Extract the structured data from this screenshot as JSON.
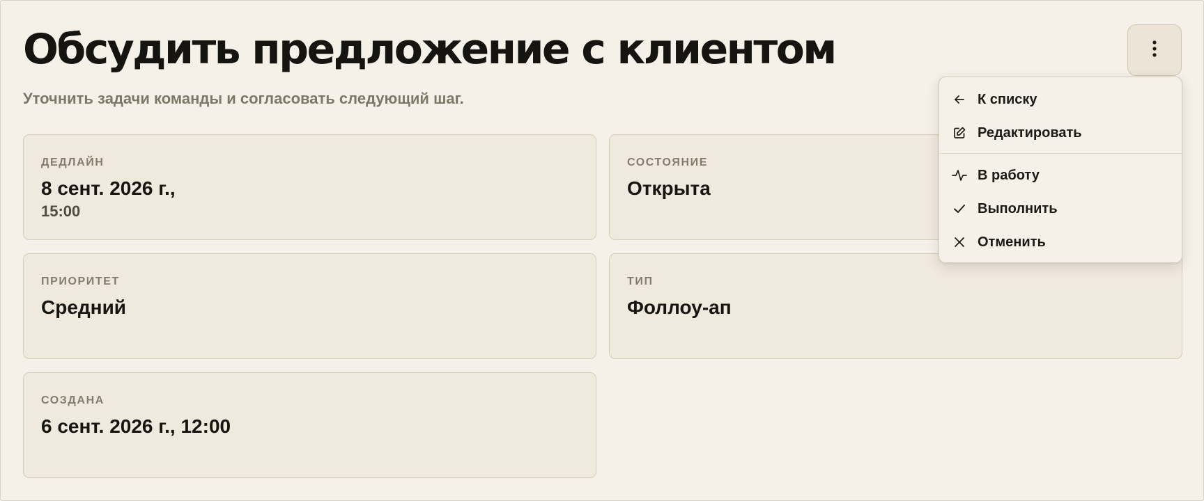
{
  "task": {
    "title": "Обсудить предложение с клиентом",
    "subtitle": "Уточнить задачи команды и согласовать следующий шаг."
  },
  "menu_button": {
    "icon": "more-vertical-icon"
  },
  "cards": {
    "deadline": {
      "label": "ДЕДЛАЙН",
      "value": "8 сент. 2026 г.,",
      "subvalue": "15:00"
    },
    "status": {
      "label": "СОСТОЯНИЕ",
      "value": "Открыта"
    },
    "priority": {
      "label": "ПРИОРИТЕТ",
      "value": "Средний"
    },
    "type": {
      "label": "ТИП",
      "value": "Фоллоу-ап"
    },
    "created": {
      "label": "СОЗДАНА",
      "value": "6 сент. 2026 г., 12:00"
    }
  },
  "dropdown": {
    "items": [
      {
        "label": "К списку",
        "icon": "arrow-left-icon"
      },
      {
        "label": "Редактировать",
        "icon": "edit-icon"
      },
      {
        "label": "В работу",
        "icon": "activity-icon"
      },
      {
        "label": "Выполнить",
        "icon": "check-icon"
      },
      {
        "label": "Отменить",
        "icon": "x-icon"
      }
    ]
  },
  "colors": {
    "background": "#f5f1e9",
    "card_background": "#f0e9de",
    "text": "#171510",
    "muted_text": "#837c6e"
  }
}
